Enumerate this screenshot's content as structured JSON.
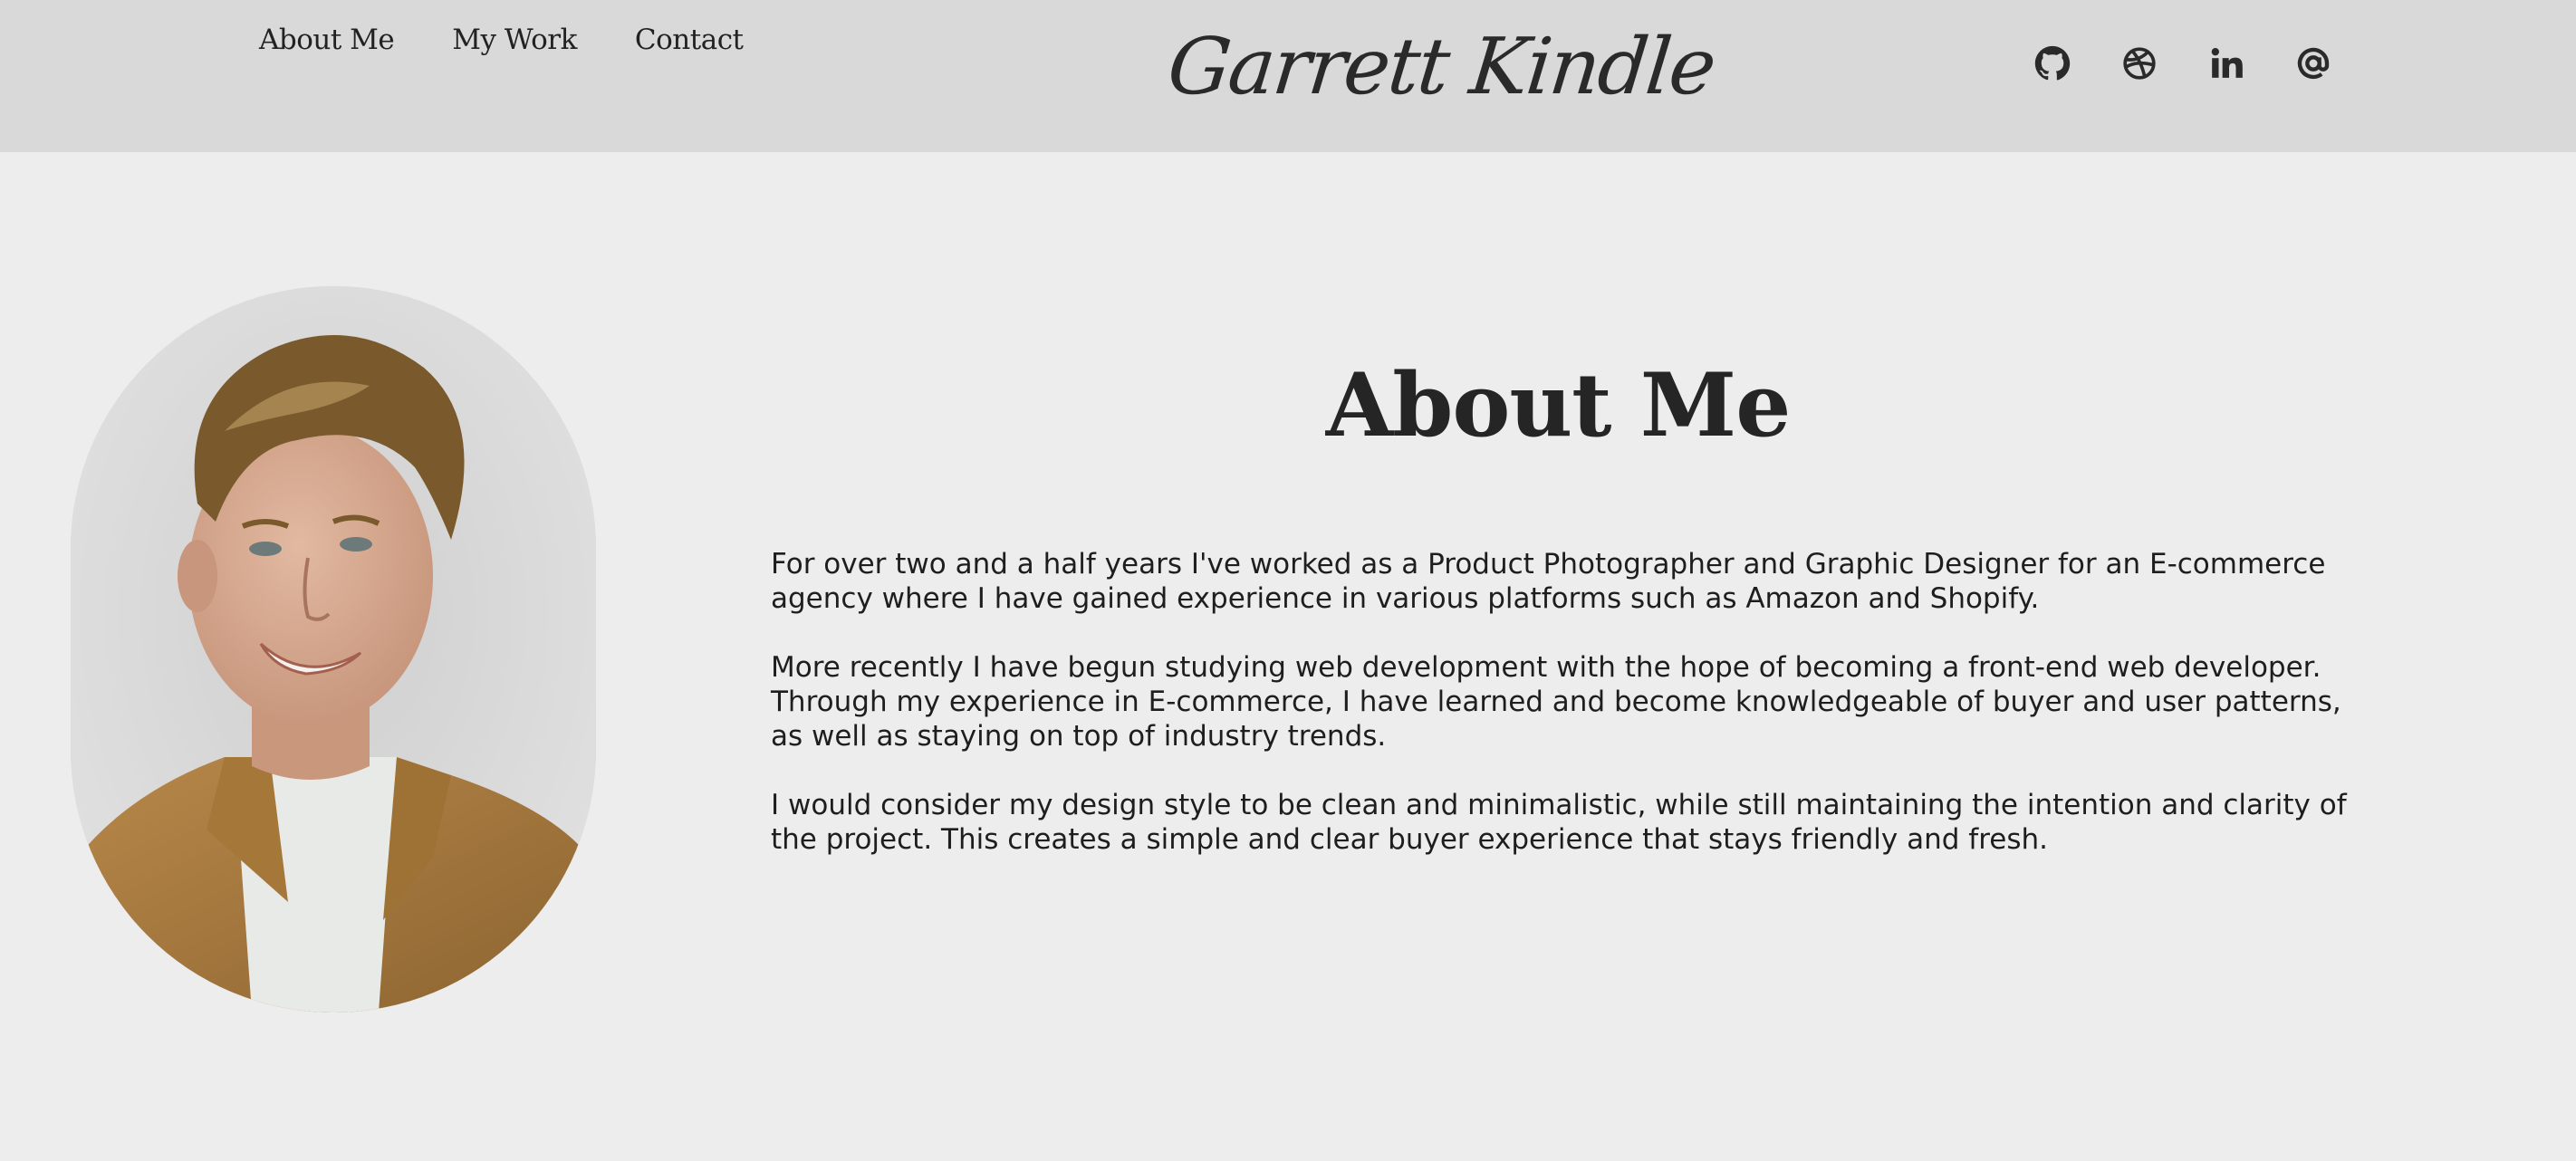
{
  "nav": {
    "items": [
      {
        "label": "About Me"
      },
      {
        "label": "My Work"
      },
      {
        "label": "Contact"
      }
    ]
  },
  "logo": {
    "text": "Garrett Kindle"
  },
  "social": {
    "icons": [
      "github-icon",
      "dribbble-icon",
      "linkedin-icon",
      "email-at-icon"
    ]
  },
  "about": {
    "heading": "About Me",
    "paragraphs": [
      "For over two and a half years I've worked as a Product Photographer and Graphic Designer for an E-commerce agency where I have gained experience in various platforms such as Amazon and Shopify.",
      "More recently I have begun studying web development with the hope of becoming a front-end web developer. Through my experience in E-commerce, I have learned and become knowledgeable of buyer and user patterns, as well as staying on top of industry trends.",
      "I would consider my design style to be clean and minimalistic, while still maintaining the intention and clarity of the project. This creates a simple and clear buyer experience that stays friendly and fresh."
    ]
  },
  "colors": {
    "header_bg": "#d9d9d9",
    "page_bg": "#ededed",
    "text": "#222222"
  }
}
